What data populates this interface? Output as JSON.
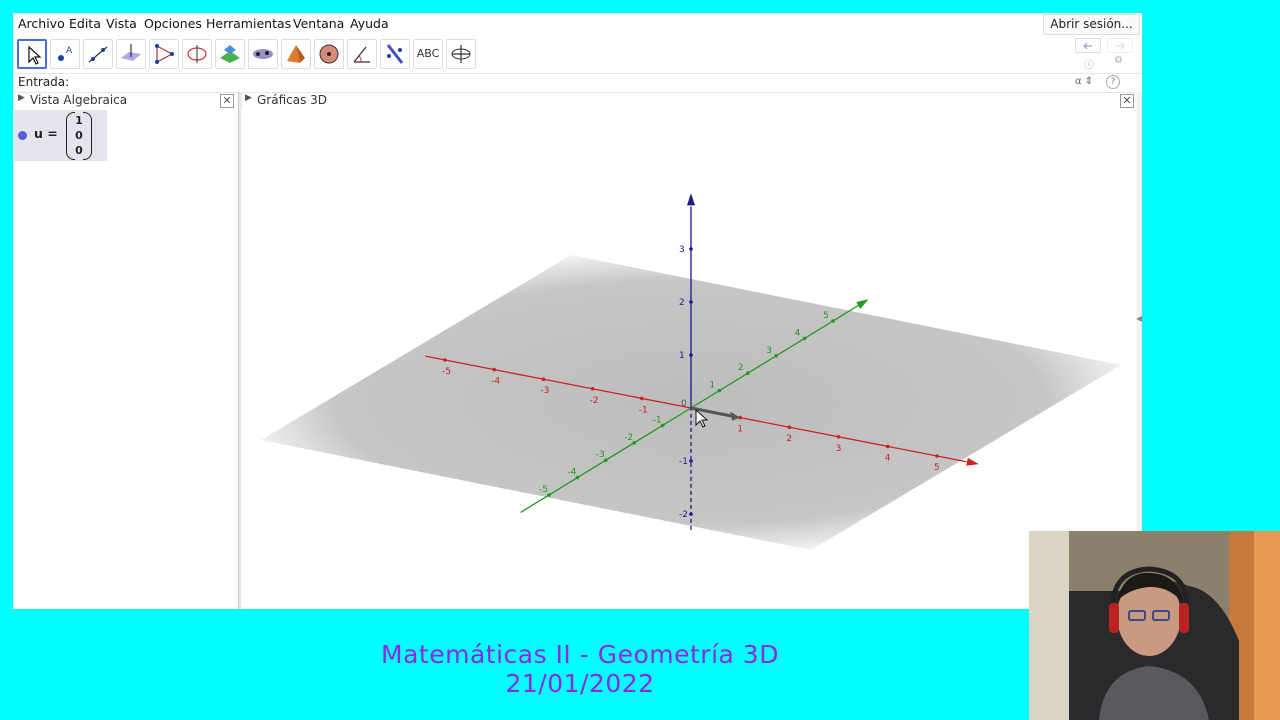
{
  "menu": [
    "Archivo",
    "Edita",
    "Vista",
    "Opciones",
    "Herramientas",
    "Ventana",
    "Ayuda"
  ],
  "login_label": "Abrir sesión...",
  "toolbar": {
    "text_tool_label": "ABC",
    "tools": [
      "move-tool-icon",
      "point-tool-icon",
      "line-tool-icon",
      "perpendicular-tool-icon",
      "polygon-tool-icon",
      "circle-tool-icon",
      "intersect-surfaces-icon",
      "plane-tool-icon",
      "pyramid-tool-icon",
      "sphere-tool-icon",
      "angle-tool-icon",
      "reflect-tool-icon",
      "text-tool-icon",
      "rotate-view-icon"
    ]
  },
  "input_bar": {
    "label": "Entrada:",
    "value": "",
    "alpha": "α ⇕"
  },
  "algebra_view": {
    "title": "Vista Algebraica",
    "item": {
      "label": "u =",
      "vector": [
        "1",
        "0",
        "0"
      ],
      "color": "#5b5bd6"
    }
  },
  "graphics_view": {
    "title": "Gráficas 3D",
    "x_ticks": [
      "-5",
      "-4",
      "-3",
      "-2",
      "-1",
      "1",
      "2",
      "3",
      "4",
      "5"
    ],
    "y_ticks": [
      "-5",
      "-4",
      "-3",
      "-2",
      "-1",
      "1",
      "2",
      "3",
      "4",
      "5"
    ],
    "z_ticks": [
      "3",
      "2",
      "1",
      "-1",
      "-2"
    ],
    "origin": "0",
    "colors": {
      "x_axis": "#cc2222",
      "y_axis": "#229922",
      "z_axis": "#1a1a8a"
    }
  },
  "caption": {
    "line1": "Matemáticas II   -    Geometría 3D",
    "line2": "21/01/2022",
    "color": "#8a2be2"
  },
  "background_color": "#00ffff"
}
